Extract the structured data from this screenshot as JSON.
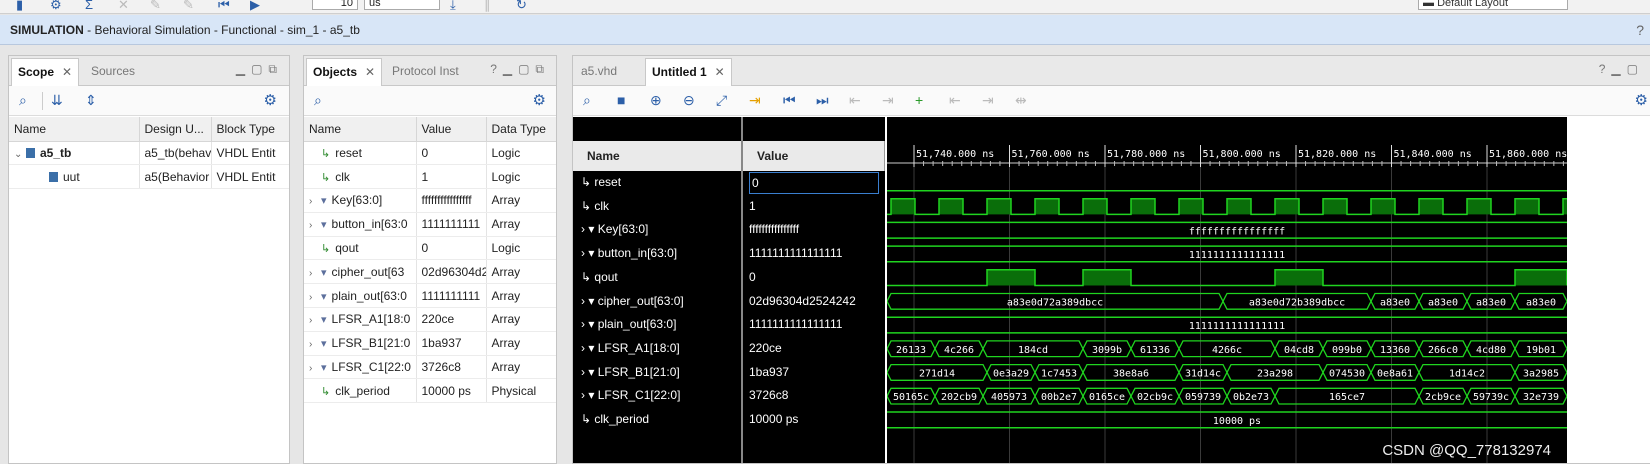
{
  "top_toolbar": {
    "time_value": "10",
    "time_unit": "us",
    "layout": "Default Layout"
  },
  "sim_bar": {
    "prefix": "SIMULATION",
    "text": " - Behavioral Simulation - Functional - sim_1 - a5_tb",
    "help": "?"
  },
  "scope_panel": {
    "tabs": [
      "Scope",
      "Sources"
    ],
    "columns": [
      "Name",
      "Design U...",
      "Block Type"
    ],
    "rows": [
      {
        "name": "a5_tb",
        "design_unit": "a5_tb(behav",
        "block_type": "VHDL Entit"
      },
      {
        "name": "uut",
        "design_unit": "a5(Behavior",
        "block_type": "VHDL Entit"
      }
    ]
  },
  "objects_panel": {
    "tabs": [
      "Objects",
      "Protocol Inst"
    ],
    "columns": [
      "Name",
      "Value",
      "Data Type"
    ],
    "rows": [
      {
        "name": "reset",
        "value": "0",
        "type": "Logic",
        "kind": "logic"
      },
      {
        "name": "clk",
        "value": "1",
        "type": "Logic",
        "kind": "logic"
      },
      {
        "name": "Key[63:0]",
        "value": "ffffffffffffffff",
        "type": "Array",
        "kind": "array"
      },
      {
        "name": "button_in[63:0",
        "value": "1111111111",
        "type": "Array",
        "kind": "array"
      },
      {
        "name": "qout",
        "value": "0",
        "type": "Logic",
        "kind": "logic"
      },
      {
        "name": "cipher_out[63",
        "value": "02d96304d2",
        "type": "Array",
        "kind": "array"
      },
      {
        "name": "plain_out[63:0",
        "value": "1111111111",
        "type": "Array",
        "kind": "array"
      },
      {
        "name": "LFSR_A1[18:0",
        "value": "220ce",
        "type": "Array",
        "kind": "array"
      },
      {
        "name": "LFSR_B1[21:0",
        "value": "1ba937",
        "type": "Array",
        "kind": "array"
      },
      {
        "name": "LFSR_C1[22:0",
        "value": "3726c8",
        "type": "Array",
        "kind": "array"
      },
      {
        "name": "clk_period",
        "value": "10000 ps",
        "type": "Physical",
        "kind": "logic"
      }
    ]
  },
  "wave_panel": {
    "tabs": [
      "a5.vhd",
      "Untitled 1"
    ],
    "name_header": "Name",
    "value_header": "Value",
    "signals": [
      {
        "name": "reset",
        "value": "0",
        "kind": "logic"
      },
      {
        "name": "clk",
        "value": "1",
        "kind": "logic"
      },
      {
        "name": "Key[63:0]",
        "value": "ffffffffffffffff",
        "kind": "array"
      },
      {
        "name": "button_in[63:0]",
        "value": "1111111111111111",
        "kind": "array"
      },
      {
        "name": "qout",
        "value": "0",
        "kind": "logic"
      },
      {
        "name": "cipher_out[63:0]",
        "value": "02d96304d2524242",
        "kind": "array"
      },
      {
        "name": "plain_out[63:0]",
        "value": "1111111111111111",
        "kind": "array"
      },
      {
        "name": "LFSR_A1[18:0]",
        "value": "220ce",
        "kind": "array"
      },
      {
        "name": "LFSR_B1[21:0]",
        "value": "1ba937",
        "kind": "array"
      },
      {
        "name": "LFSR_C1[22:0]",
        "value": "3726c8",
        "kind": "array"
      },
      {
        "name": "clk_period",
        "value": "10000 ps",
        "kind": "logic"
      }
    ],
    "time_ticks": [
      "51,740.000 ns",
      "51,760.000 ns",
      "51,780.000 ns",
      "51,800.000 ns",
      "51,820.000 ns",
      "51,840.000 ns",
      "51,860.000 ns"
    ],
    "traces": {
      "key_label": "ffffffffffffffff",
      "button_label": "1111111111111111",
      "plain_label": "1111111111111111",
      "clk_period_label": "10000 ps",
      "cipher": [
        "a83e0d72a389dbcc",
        "a83e0d72b389dbcc",
        "a83e0",
        "a83e0",
        "a83e0",
        "a83e0"
      ],
      "lfsr_a1": [
        "26133",
        "4c266",
        "184cd",
        "3099b",
        "61336",
        "4266c",
        "04cd8",
        "099b0",
        "13360",
        "266c0",
        "4cd80",
        "19b01"
      ],
      "lfsr_b1": [
        "271d14",
        "0e3a29",
        "1c7453",
        "38e8a6",
        "31d14c",
        "23a298",
        "074530",
        "0e8a61",
        "1d14c2",
        "3a2985"
      ],
      "lfsr_c1": [
        "50165c",
        "202cb9",
        "405973",
        "00b2e7",
        "0165ce",
        "02cb9c",
        "059739",
        "0b2e73",
        "165ce7",
        "2cb9ce",
        "59739c",
        "32e739"
      ]
    },
    "watermark": "CSDN @QQ_778132974"
  },
  "colors": {
    "wave_green": "#1fd41f",
    "wave_fill": "#0a6e0a",
    "wave_bg": "#000000"
  }
}
